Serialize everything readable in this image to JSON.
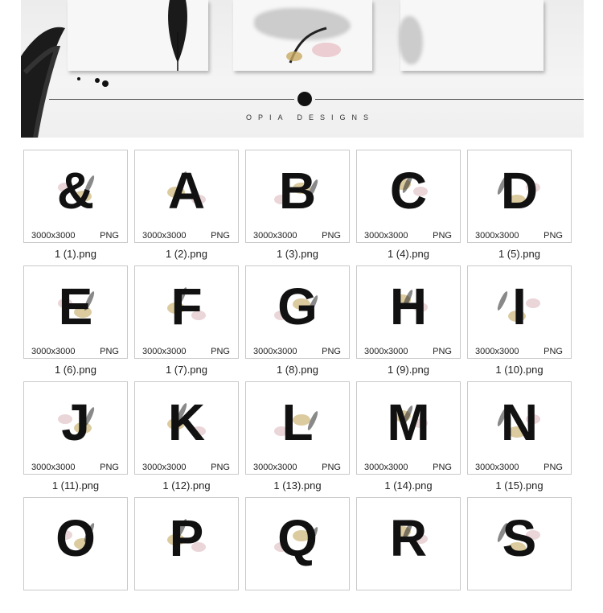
{
  "banner": {
    "brand": "OPIA DESIGNS"
  },
  "files": [
    {
      "letter": "&",
      "dims": "3000x3000",
      "format": "PNG",
      "name": "1 (1).png"
    },
    {
      "letter": "A",
      "dims": "3000x3000",
      "format": "PNG",
      "name": "1 (2).png"
    },
    {
      "letter": "B",
      "dims": "3000x3000",
      "format": "PNG",
      "name": "1 (3).png"
    },
    {
      "letter": "C",
      "dims": "3000x3000",
      "format": "PNG",
      "name": "1 (4).png"
    },
    {
      "letter": "D",
      "dims": "3000x3000",
      "format": "PNG",
      "name": "1 (5).png"
    },
    {
      "letter": "E",
      "dims": "3000x3000",
      "format": "PNG",
      "name": "1 (6).png"
    },
    {
      "letter": "F",
      "dims": "3000x3000",
      "format": "PNG",
      "name": "1 (7).png"
    },
    {
      "letter": "G",
      "dims": "3000x3000",
      "format": "PNG",
      "name": "1 (8).png"
    },
    {
      "letter": "H",
      "dims": "3000x3000",
      "format": "PNG",
      "name": "1 (9).png"
    },
    {
      "letter": "I",
      "dims": "3000x3000",
      "format": "PNG",
      "name": "1 (10).png"
    },
    {
      "letter": "J",
      "dims": "3000x3000",
      "format": "PNG",
      "name": "1 (11).png"
    },
    {
      "letter": "K",
      "dims": "3000x3000",
      "format": "PNG",
      "name": "1 (12).png"
    },
    {
      "letter": "L",
      "dims": "3000x3000",
      "format": "PNG",
      "name": "1 (13).png"
    },
    {
      "letter": "M",
      "dims": "3000x3000",
      "format": "PNG",
      "name": "1 (14).png"
    },
    {
      "letter": "N",
      "dims": "3000x3000",
      "format": "PNG",
      "name": "1 (15).png"
    },
    {
      "letter": "O",
      "dims": "",
      "format": "",
      "name": ""
    },
    {
      "letter": "P",
      "dims": "",
      "format": "",
      "name": ""
    },
    {
      "letter": "Q",
      "dims": "",
      "format": "",
      "name": ""
    },
    {
      "letter": "R",
      "dims": "",
      "format": "",
      "name": ""
    },
    {
      "letter": "S",
      "dims": "",
      "format": "",
      "name": ""
    }
  ]
}
